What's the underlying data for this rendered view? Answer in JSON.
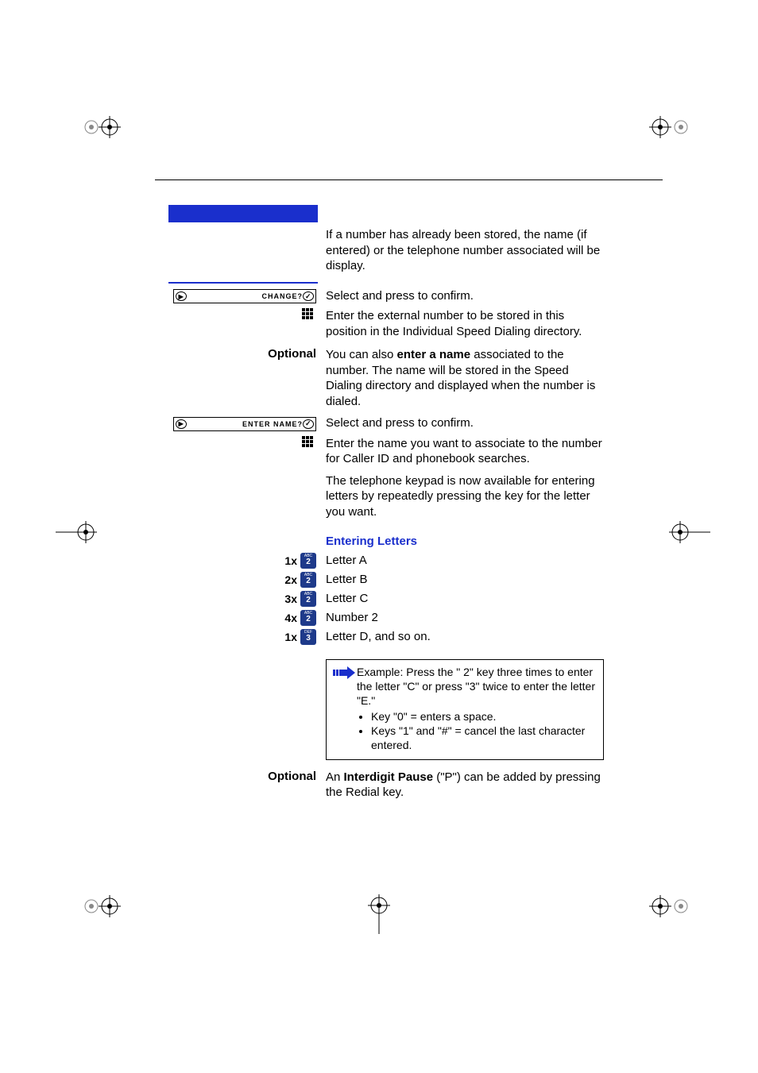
{
  "intro": "If a number has already been stored, the name (if entered) or the telephone number associated will be display.",
  "change": {
    "display": "CHANGE?",
    "desc": "Select and press to confirm."
  },
  "enterNumber": "Enter the external number to be stored in this position in the Individual Speed Dialing directory.",
  "optional1Label": "Optional",
  "optional1": {
    "prefix": "You can also ",
    "bold": "enter a name",
    "suffix": " associated to the number. The name will be stored in the Speed Dialing directory and displayed when the number is dialed."
  },
  "enterName": {
    "display": "ENTER  NAME?",
    "desc": "Select and press to confirm."
  },
  "enterNameDesc": "Enter the name you want to associate to the number for Caller ID and phonebook searches.",
  "keypadDesc": "The telephone keypad is now available for entering letters by repeatedly pressing the key for the letter you want.",
  "lettersTitle": "Entering Letters",
  "letters": [
    {
      "count": "1x",
      "sup": "ABC",
      "num": "2",
      "desc": "Letter A"
    },
    {
      "count": "2x",
      "sup": "ABC",
      "num": "2",
      "desc": "Letter B"
    },
    {
      "count": "3x",
      "sup": "ABC",
      "num": "2",
      "desc": "Letter C"
    },
    {
      "count": "4x",
      "sup": "ABC",
      "num": "2",
      "desc": "Number 2"
    },
    {
      "count": "1x",
      "sup": "DEF",
      "num": "3",
      "desc": "Letter D, and so on."
    }
  ],
  "note": {
    "intro": "Example: Press the \" 2\" key three times to enter the letter \"C\" or press \"3\" twice to enter the letter \"E.\"",
    "b1": "Key \"0\" = enters a space.",
    "b2": "Keys \"1\" and \"#\" = cancel the last character entered."
  },
  "optional2Label": "Optional",
  "optional2": {
    "prefix": "An ",
    "bold": "Interdigit Pause",
    "suffix": " (\"P\") can be added by pressing the Redial key."
  }
}
